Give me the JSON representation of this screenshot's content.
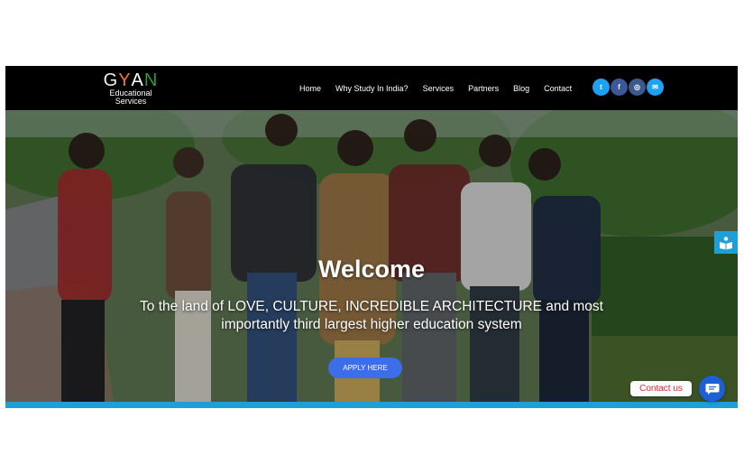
{
  "logo": {
    "letters": [
      "G",
      "Y",
      "A",
      "N"
    ],
    "letter_colors": [
      "#f0f0f0",
      "#e87a2a",
      "#ffffff",
      "#2f9a3a"
    ],
    "subtitle_line1": "Educational",
    "subtitle_line2": "Services"
  },
  "nav": {
    "items": [
      "Home",
      "Why Study In India?",
      "Services",
      "Partners",
      "Blog",
      "Contact"
    ]
  },
  "socials": [
    {
      "icon": "twitter-icon",
      "glyph": "t",
      "color": "#1da1f2"
    },
    {
      "icon": "facebook-icon",
      "glyph": "f",
      "color": "#3b5998"
    },
    {
      "icon": "instagram-icon",
      "glyph": "◎",
      "color": "#3a5a8c"
    },
    {
      "icon": "email-icon",
      "glyph": "✉",
      "color": "#1da1f2"
    }
  ],
  "hero": {
    "title": "Welcome",
    "tagline": "To the land of LOVE, CULTURE, INCREDIBLE ARCHITECTURE and most importantly third largest higher education system",
    "button": "APPLY HERE"
  },
  "widgets": {
    "contact_label": "Contact us",
    "side_tab_icon": "book-reader-icon",
    "chat_icon": "chat-icon"
  },
  "colors": {
    "nav_bg": "#000000",
    "accent": "#1f9fd8",
    "button": "#3b6ee8",
    "contact_text": "#e8232c"
  }
}
